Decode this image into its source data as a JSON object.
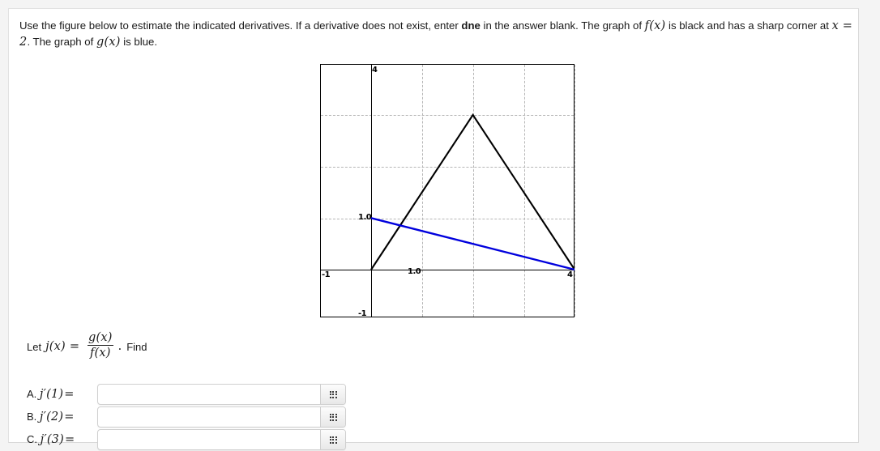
{
  "prompt": {
    "part1": "Use the figure below to estimate the indicated derivatives. If a derivative does not exist, enter ",
    "dne": "dne",
    "part2": " in the answer blank. The graph of ",
    "fx": "f(x)",
    "part3": " is black and has a sharp corner at ",
    "x_eq": "x = 2",
    "part4": ". The graph of ",
    "gx": "g(x)",
    "part5": " is blue."
  },
  "definition": {
    "let": "Let",
    "j_of_x": "j(x)",
    "equals": "=",
    "numerator": "g(x)",
    "denominator": "f(x)",
    "period": ".",
    "find": "Find"
  },
  "answers": [
    {
      "letter": "A.",
      "expr": "j′(1)",
      "equals": "=",
      "value": "",
      "placeholder": "",
      "keypad_icon": "keypad-grid-icon"
    },
    {
      "letter": "B.",
      "expr": "j′(2)",
      "equals": "=",
      "value": "",
      "placeholder": "",
      "keypad_icon": "keypad-grid-icon"
    },
    {
      "letter": "C.",
      "expr": "j′(3)",
      "equals": "=",
      "value": "",
      "placeholder": "",
      "keypad_icon": "keypad-grid-icon"
    }
  ],
  "chart_data": {
    "type": "line",
    "title": "",
    "xlabel": "",
    "ylabel": "",
    "xlim": [
      -1,
      4.3
    ],
    "ylim": [
      -1.2,
      4.2
    ],
    "grid": true,
    "legend": "none",
    "axis_labels": {
      "x_left": "-1",
      "x_one": "1.0",
      "x_right": "4",
      "y_top": "4",
      "y_one": "1.0",
      "y_bottom": "-1"
    },
    "xticks": [
      -1,
      1,
      2,
      3,
      4
    ],
    "yticks": [
      -1,
      1,
      2,
      3,
      4
    ],
    "series": [
      {
        "name": "f(x)",
        "color": "#000000",
        "style": "piecewise-linear",
        "note": "black, sharp corner at x = 2",
        "points": [
          [
            0,
            0
          ],
          [
            2,
            3
          ],
          [
            4,
            0
          ]
        ]
      },
      {
        "name": "g(x)",
        "color": "#0000dd",
        "style": "linear",
        "note": "blue straight line",
        "points": [
          [
            0,
            1
          ],
          [
            4,
            0
          ]
        ]
      }
    ]
  }
}
